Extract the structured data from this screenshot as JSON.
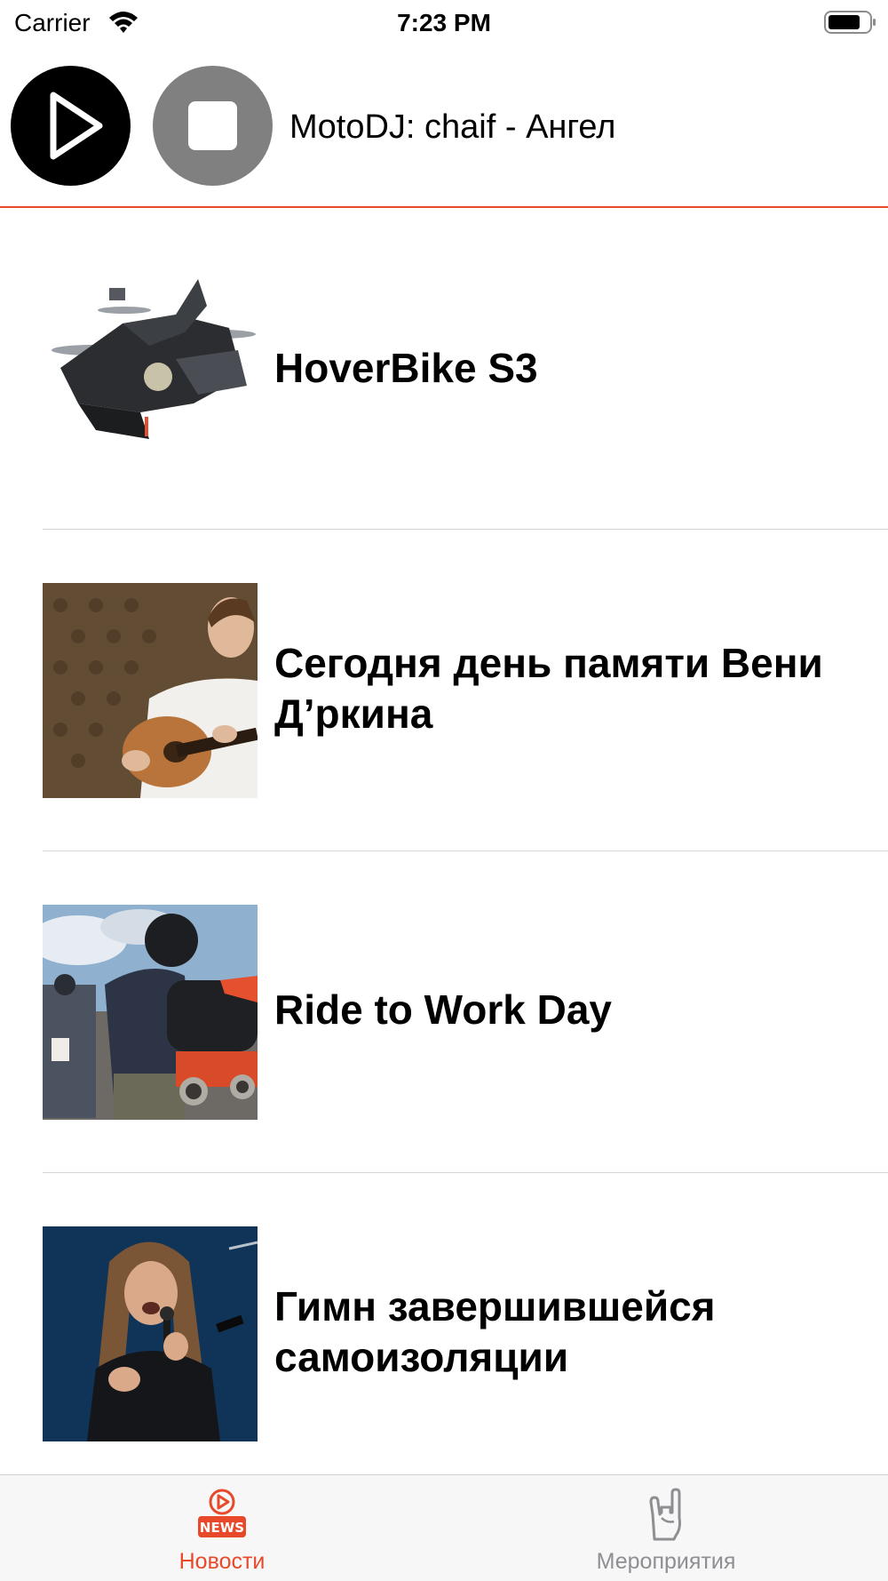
{
  "status_bar": {
    "carrier": "Carrier",
    "time": "7:23 PM",
    "wifi_icon": "wifi-icon",
    "battery_icon": "battery-icon"
  },
  "player": {
    "play_icon": "play-icon",
    "stop_icon": "stop-icon",
    "now_playing": "MotoDJ: chaif - Ангел",
    "accent_color": "#e8492a"
  },
  "news": {
    "items": [
      {
        "title": "HoverBike S3",
        "image": "hoverbike-photo"
      },
      {
        "title": "Сегодня день памяти Вени Д’ркина",
        "image": "guitarist-photo"
      },
      {
        "title": "Ride to Work Day",
        "image": "motorcyclists-photo"
      },
      {
        "title": "Гимн завершившейся самоизоляции",
        "image": "rock-singer-photo"
      }
    ]
  },
  "tab_bar": {
    "tabs": [
      {
        "label": "Новости",
        "icon": "news-icon",
        "selected": true,
        "icon_text": "NEWS"
      },
      {
        "label": "Мероприятия",
        "icon": "rock-hand-icon",
        "selected": false
      }
    ],
    "active_color": "#e8492a",
    "inactive_color": "#8e8e93"
  }
}
